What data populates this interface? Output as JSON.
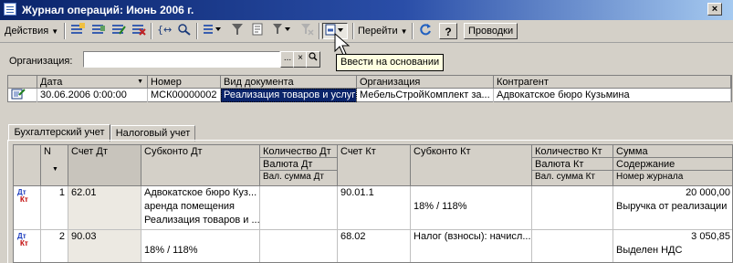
{
  "window": {
    "title": "Журнал операций: Июнь 2006 г.",
    "close_glyph": "×"
  },
  "toolbar": {
    "actions_label": "Действия",
    "goto_label": "Перейти",
    "postings_label": "Проводки",
    "help_label": "?",
    "tooltip": "Ввести на основании"
  },
  "filter": {
    "org_label": "Организация:",
    "org_value": "",
    "more_btn": "...",
    "clear_btn": "×"
  },
  "journal": {
    "columns": [
      "Дата",
      "Номер",
      "Вид документа",
      "Организация",
      "Контрагент"
    ],
    "rows": [
      {
        "date": "30.06.2006 0:00:00",
        "number": "МСК00000002",
        "doc_type": "Реализация товаров и услуг",
        "org": "МебельСтройКомплект за...",
        "counterparty": "Адвокатское бюро Кузьмина"
      }
    ]
  },
  "tabs": [
    "Бухгалтерский учет",
    "Налоговый учет"
  ],
  "postings": {
    "headers": {
      "n": "N",
      "acc_dt": "Счет Дт",
      "sub_dt": "Субконто Дт",
      "qty_dt": "Количество Дт",
      "cur_dt": "Валюта Дт",
      "valsum_dt": "Вал. сумма Дт",
      "acc_kt": "Счет Кт",
      "sub_kt": "Субконто Кт",
      "qty_kt": "Количество Кт",
      "cur_kt": "Валюта Кт",
      "valsum_kt": "Вал. сумма Кт",
      "sum": "Сумма",
      "content": "Содержание",
      "journal_no": "Номер журнала"
    },
    "rows": [
      {
        "n": "1",
        "acc_dt": "62.01",
        "sub_dt": [
          "Адвокатское бюро Куз...",
          "аренда помещения",
          "Реализация товаров и ..."
        ],
        "acc_kt": "90.01.1",
        "sub_kt": [
          "",
          "18% / 118%",
          ""
        ],
        "sum": "20 000,00",
        "content": "Выручка от реализации"
      },
      {
        "n": "2",
        "acc_dt": "90.03",
        "sub_dt": [
          "",
          "18% / 118%",
          ""
        ],
        "acc_kt": "68.02",
        "sub_kt": [
          "Налог (взносы): начисл...",
          "",
          ""
        ],
        "sum": "3 050,85",
        "content": "Выделен НДС"
      }
    ],
    "icon_dt": "Дт",
    "icon_kt": "Кт"
  }
}
